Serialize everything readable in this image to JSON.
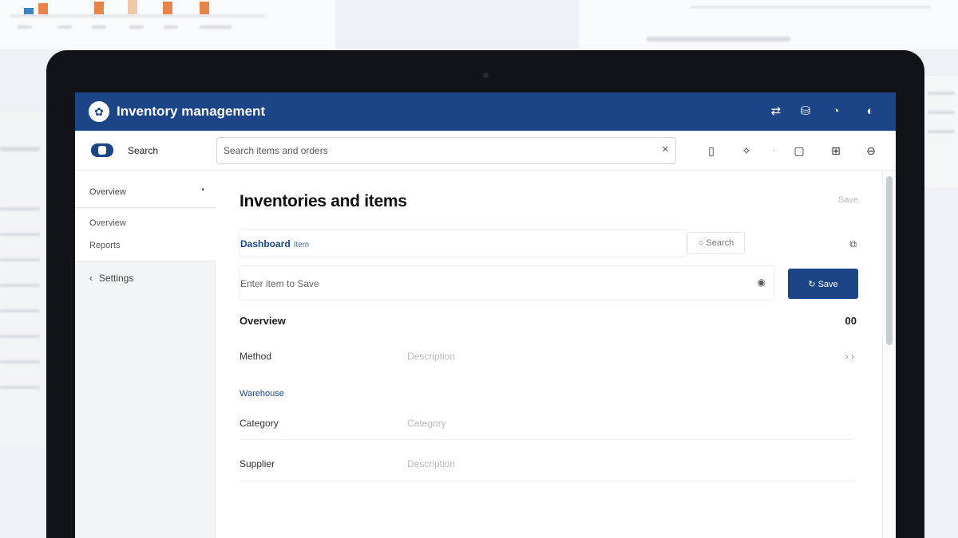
{
  "app": {
    "title": "Inventory management"
  },
  "header_icons": [
    "swap-icon",
    "bag-icon",
    "bell-icon",
    "user-icon"
  ],
  "toolbar": {
    "brand_label": "Search",
    "search_placeholder": "Search items and orders",
    "clear_glyph": "✕",
    "icons": [
      "device-icon",
      "magic-icon",
      "more-icon",
      "square-icon",
      "grid-icon",
      "logout-icon"
    ]
  },
  "sidebar": {
    "head_label": "Overview",
    "items": [
      "Overview",
      "Reports"
    ],
    "link_label": "Settings"
  },
  "main": {
    "title": "Inventories and items",
    "page_action": "Save",
    "filter_label": "Dashboard",
    "filter_sub": "Item",
    "filter_chip": "Search",
    "entry_placeholder": "Enter item to Save",
    "primary_button": "Save",
    "section_title": "Overview",
    "section_count": "00",
    "rows": [
      {
        "key": "Method",
        "value": "Description",
        "right": "› ›"
      },
      {
        "key": "Warehouse",
        "value": "",
        "right": ""
      },
      {
        "key": "Category",
        "value": "Category",
        "right": ""
      },
      {
        "key": "Supplier",
        "value": "Description",
        "right": ""
      }
    ]
  },
  "colors": {
    "brand": "#1c4587",
    "sidebar_bg": "#f3f4f6"
  }
}
